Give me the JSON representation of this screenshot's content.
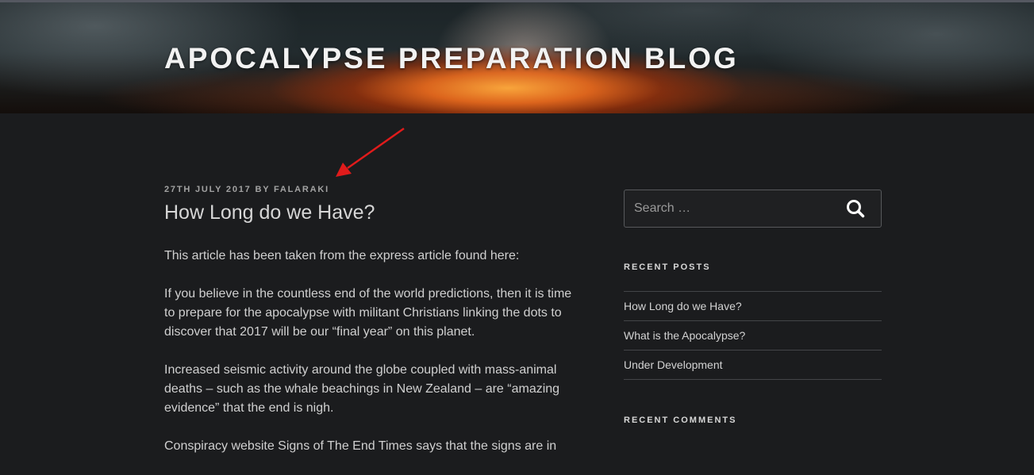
{
  "header": {
    "site_title": "APOCALYPSE PREPARATION BLOG"
  },
  "post": {
    "date": "27TH JULY 2017",
    "by": "BY",
    "author": "FALARAKI",
    "title": "How Long do we Have?",
    "paragraphs": [
      "This article has been taken from the express article found here:",
      "If you believe in the countless end of the world predictions, then it is time to prepare for the apocalypse with militant Christians linking the dots to discover that 2017 will be our “final year” on this planet.",
      "Increased seismic activity around the globe coupled with mass-animal deaths – such as the whale beachings in New Zealand – are “amazing evidence” that the end is nigh.",
      "Conspiracy website Signs of The End Times says that the signs are in"
    ]
  },
  "sidebar": {
    "search_placeholder": "Search …",
    "recent_posts_title": "RECENT POSTS",
    "recent_posts": [
      "How Long do we Have?",
      "What is the Apocalypse?",
      "Under Development"
    ],
    "recent_comments_title": "RECENT COMMENTS"
  },
  "colors": {
    "background": "#1b1c1e",
    "annotation_arrow": "#e01b1b"
  },
  "icons": {
    "search": "search-icon",
    "annotation": "red-arrow-annotation"
  }
}
